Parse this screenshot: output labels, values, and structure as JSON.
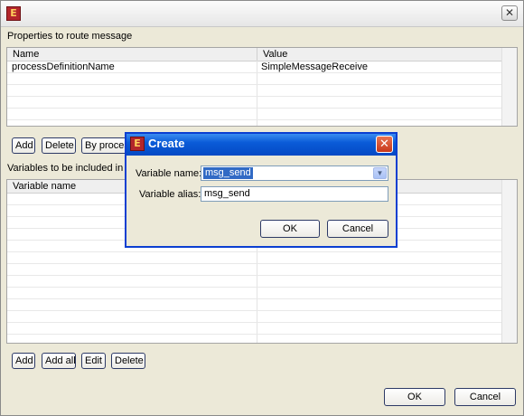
{
  "window": {
    "close_glyph": "✕",
    "app_icon_glyph": "E"
  },
  "properties": {
    "label": "Properties to route message",
    "columns": [
      "Name",
      "Value"
    ],
    "rows": [
      {
        "name": "processDefinitionName",
        "value": "SimpleMessageReceive"
      }
    ],
    "buttons": {
      "add": "Add",
      "delete": "Delete",
      "by_process": "By process"
    }
  },
  "variables": {
    "label": "Variables to be included in message",
    "columns": [
      "Variable name"
    ],
    "buttons": {
      "add": "Add",
      "add_all": "Add all",
      "edit": "Edit",
      "delete": "Delete"
    }
  },
  "footer": {
    "ok": "OK",
    "cancel": "Cancel"
  },
  "create_dialog": {
    "title": "Create",
    "close_glyph": "✕",
    "variable_name_label": "Variable name:",
    "variable_name_value": "msg_send",
    "variable_alias_label": "Variable alias:",
    "variable_alias_value": "msg_send",
    "ok": "OK",
    "cancel": "Cancel"
  },
  "icons": {
    "app": "app-logo-icon",
    "close": "close-icon",
    "dropdown": "chevron-down-icon"
  }
}
